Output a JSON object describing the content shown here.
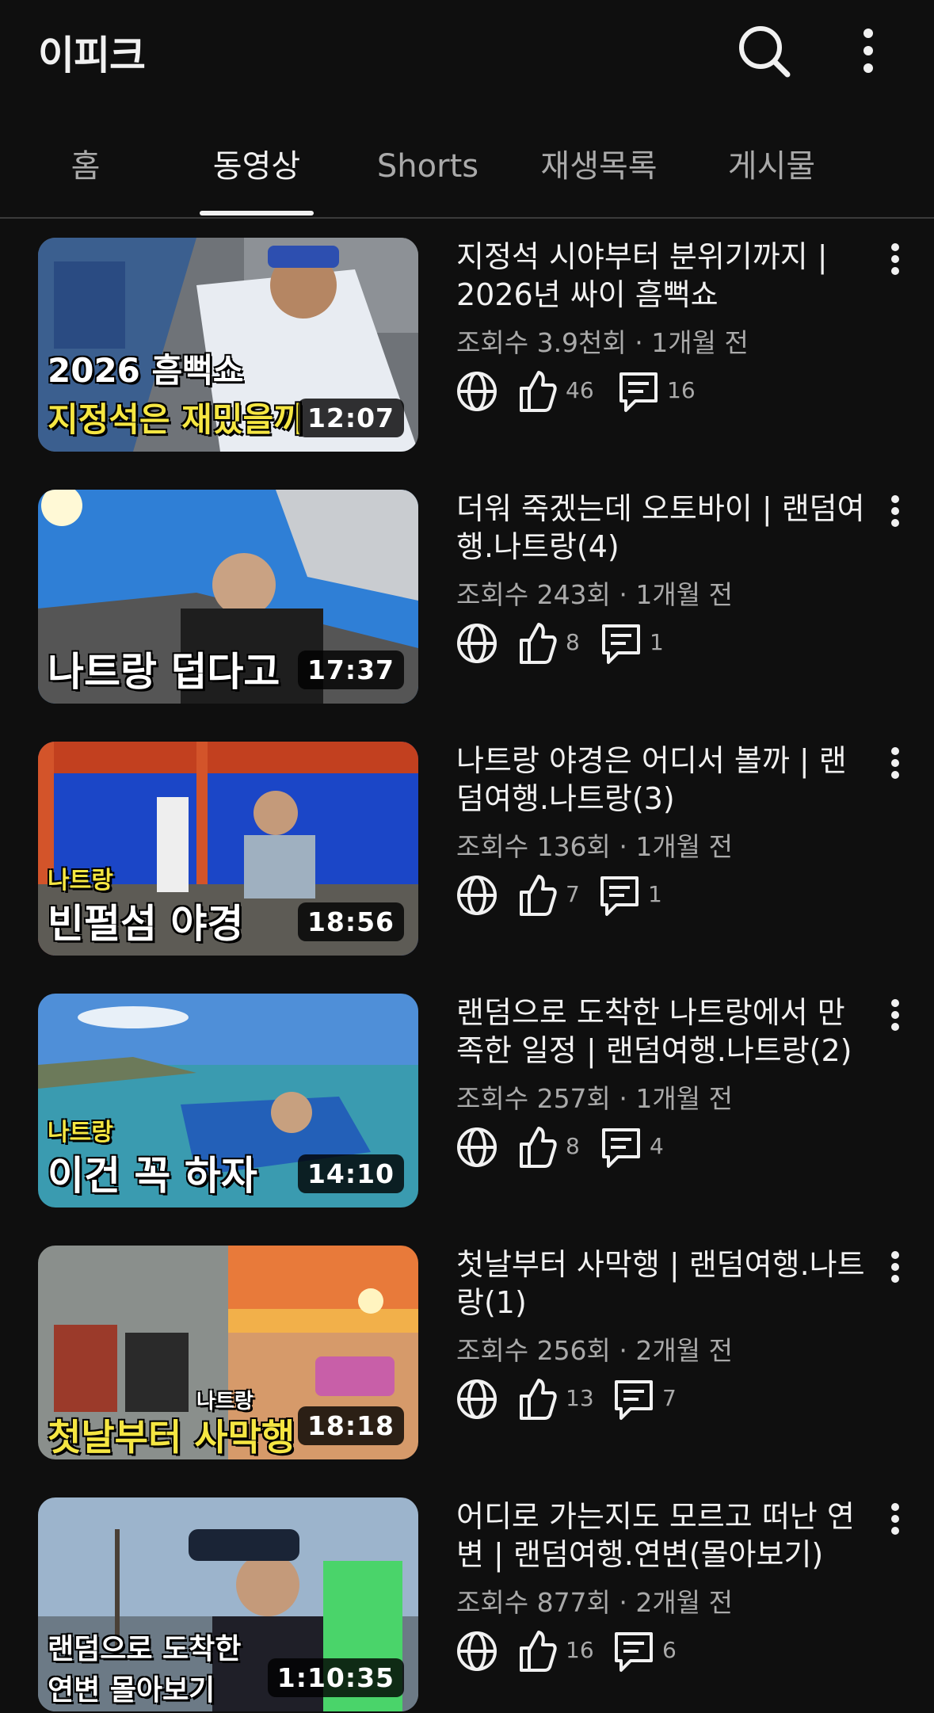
{
  "header": {
    "channel_name": "이피크",
    "icons": {
      "search": "search-icon",
      "more": "more-vert-icon"
    }
  },
  "tabs": [
    {
      "label": "홈",
      "active": false
    },
    {
      "label": "동영상",
      "active": true
    },
    {
      "label": "Shorts",
      "active": false
    },
    {
      "label": "재생목록",
      "active": false
    },
    {
      "label": "게시물",
      "active": false
    }
  ],
  "videos": [
    {
      "title": "지정석 시야부터 분위기까지 | 2026년 싸이 흠뻑쇼",
      "meta": "조회수 3.9천회 · 1개월 전",
      "likes": "46",
      "comments": "16",
      "duration": "12:07",
      "thumb_lines": [
        "2026 흠뻑쇼",
        "지정석은 재밌을끼"
      ]
    },
    {
      "title": "더워 죽겠는데 오토바이 | 랜덤여행.나트랑(4)",
      "meta": "조회수 243회 · 1개월 전",
      "likes": "8",
      "comments": "1",
      "duration": "17:37",
      "thumb_lines": [
        "나트랑 덥다고"
      ]
    },
    {
      "title": "나트랑 야경은 어디서 볼까 | 랜덤여행.나트랑(3)",
      "meta": "조회수 136회 · 1개월 전",
      "likes": "7",
      "comments": "1",
      "duration": "18:56",
      "thumb_lines": [
        "나트랑",
        "빈펄섬 야경"
      ]
    },
    {
      "title": "랜덤으로 도착한 나트랑에서 만족한 일정 | 랜덤여행.나트랑(2)",
      "meta": "조회수 257회 · 1개월 전",
      "likes": "8",
      "comments": "4",
      "duration": "14:10",
      "thumb_lines": [
        "나트랑",
        "이건 꼭 하자"
      ]
    },
    {
      "title": "첫날부터 사막행 | 랜덤여행.나트랑(1)",
      "meta": "조회수 256회 · 2개월 전",
      "likes": "13",
      "comments": "7",
      "duration": "18:18",
      "thumb_lines": [
        "나트랑",
        "첫날부터 사막행"
      ]
    },
    {
      "title": "어디로 가는지도 모르고 떠난 연변 | 랜덤여행.연변(몰아보기)",
      "meta": "조회수 877회 · 2개월 전",
      "likes": "16",
      "comments": "6",
      "duration": "1:10:35",
      "thumb_lines": [
        "랜덤으로 도착한",
        "연변 몰아보기"
      ]
    }
  ],
  "colors": {
    "background": "#0f0f0f",
    "text_primary": "#f1f1f1",
    "text_secondary": "#aaaaaa",
    "thumb_caption_yellow": "#f5e642"
  }
}
